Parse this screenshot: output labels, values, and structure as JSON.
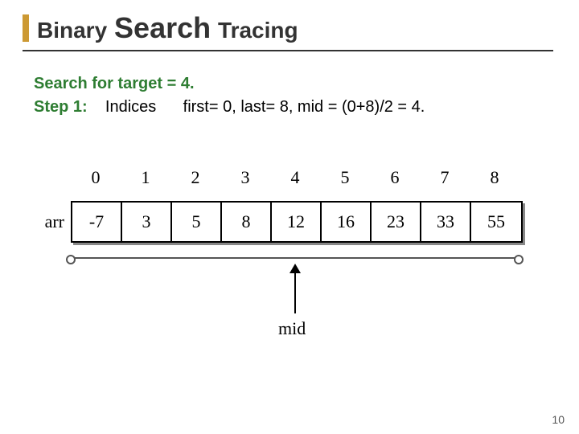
{
  "title": {
    "w1": "Binary",
    "w2": "Search",
    "w3": "Tracing"
  },
  "line1_prefix": "Search for target = 4.",
  "line2_step": "Step 1:",
  "line2_indices": "Indices",
  "line2_rest": "first= 0, last= 8, mid = (0+8)/2 = 4.",
  "arr_label": "arr",
  "indices": [
    "0",
    "1",
    "2",
    "3",
    "4",
    "5",
    "6",
    "7",
    "8"
  ],
  "values": [
    "-7",
    "3",
    "5",
    "8",
    "12",
    "16",
    "23",
    "33",
    "55"
  ],
  "mid_label": "mid",
  "page_number": "10"
}
